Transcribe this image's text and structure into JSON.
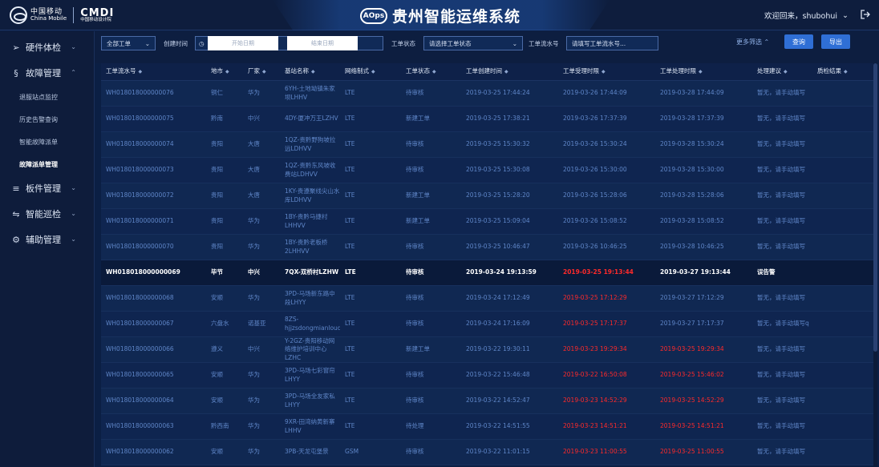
{
  "header": {
    "logo_cn": "中国移动",
    "logo_en": "China Mobile",
    "cmdi": "CMDI",
    "cmdi_sub": "中国移动设计院",
    "aops": "AOps",
    "title": "贵州智能运维系统",
    "welcome": "欢迎回来，shubohui"
  },
  "sidebar": {
    "groups": [
      {
        "label": "硬件体检",
        "icon": "device-icon"
      },
      {
        "label": "故障管理",
        "icon": "fault-icon"
      },
      {
        "label": "板件管理",
        "icon": "stack-icon"
      },
      {
        "label": "智能巡检",
        "icon": "patrol-icon"
      },
      {
        "label": "辅助管理",
        "icon": "gear-icon"
      }
    ],
    "fault_items": [
      "退服站点监控",
      "历史告警查询",
      "智能故障派单",
      "故障派单管理"
    ],
    "active_item": "故障派单管理"
  },
  "filter": {
    "order_type": "全部工单",
    "created_label": "创建时间",
    "start_placeholder": "开始日期",
    "end_placeholder": "结束日期",
    "status_label": "工单状态",
    "status_placeholder": "请选择工单状态",
    "flow_label": "工单流水号",
    "flow_placeholder": "请填写工单流水号...",
    "more": "更多筛选",
    "query": "查询",
    "export": "导出"
  },
  "table": {
    "headers": [
      "工单流水号",
      "地市",
      "厂家",
      "基站名称",
      "网络制式",
      "工单状态",
      "工单创建时间",
      "工单受理时限",
      "工单处理时限",
      "处理建议",
      "质检结果"
    ],
    "rows": [
      {
        "id": "WH018018000000076",
        "city": "铜仁",
        "vendor": "华为",
        "site": "6YH-土地坳镇朱家坝LHHV",
        "net": "LTE",
        "status": "待审核",
        "created": "2019-03-25 17:44:24",
        "accept": "2019-03-26 17:44:09",
        "accept_red": false,
        "deal": "2019-03-28 17:44:09",
        "deal_red": false,
        "advice": "暂无，请手动填写",
        "qc": ""
      },
      {
        "id": "WH018018000000075",
        "city": "黔南",
        "vendor": "中兴",
        "site": "4DY-厦冲万王LZHV",
        "net": "LTE",
        "status": "新建工单",
        "created": "2019-03-25 17:38:21",
        "accept": "2019-03-26 17:37:39",
        "accept_red": false,
        "deal": "2019-03-28 17:37:39",
        "deal_red": false,
        "advice": "暂无，请手动填写",
        "qc": ""
      },
      {
        "id": "WH018018000000074",
        "city": "贵阳",
        "vendor": "大唐",
        "site": "1QZ-贵黔野狗坡拉远LDHVV",
        "net": "LTE",
        "status": "待审核",
        "created": "2019-03-25 15:30:32",
        "accept": "2019-03-26 15:30:24",
        "accept_red": false,
        "deal": "2019-03-28 15:30:24",
        "deal_red": false,
        "advice": "暂无，请手动填写",
        "qc": ""
      },
      {
        "id": "WH018018000000073",
        "city": "贵阳",
        "vendor": "大唐",
        "site": "1QZ-贵黔东风坡收费站LDHVV",
        "net": "LTE",
        "status": "待审核",
        "created": "2019-03-25 15:30:08",
        "accept": "2019-03-26 15:30:00",
        "accept_red": false,
        "deal": "2019-03-28 15:30:00",
        "deal_red": false,
        "advice": "暂无，请手动填写",
        "qc": ""
      },
      {
        "id": "WH018018000000072",
        "city": "贵阳",
        "vendor": "大唐",
        "site": "1KY-贵遵聚线尖山水库LDHVV",
        "net": "LTE",
        "status": "新建工单",
        "created": "2019-03-25 15:28:20",
        "accept": "2019-03-26 15:28:06",
        "accept_red": false,
        "deal": "2019-03-28 15:28:06",
        "deal_red": false,
        "advice": "暂无，请手动填写",
        "qc": ""
      },
      {
        "id": "WH018018000000071",
        "city": "贵阳",
        "vendor": "华为",
        "site": "1BY-贵黔马捷村LHHVV",
        "net": "LTE",
        "status": "新建工单",
        "created": "2019-03-25 15:09:04",
        "accept": "2019-03-26 15:08:52",
        "accept_red": false,
        "deal": "2019-03-28 15:08:52",
        "deal_red": false,
        "advice": "暂无，请手动填写",
        "qc": ""
      },
      {
        "id": "WH018018000000070",
        "city": "贵阳",
        "vendor": "华为",
        "site": "1BY-贵黔老板桥2LHHVV",
        "net": "LTE",
        "status": "待审核",
        "created": "2019-03-25 10:46:47",
        "accept": "2019-03-26 10:46:25",
        "accept_red": false,
        "deal": "2019-03-28 10:46:25",
        "deal_red": false,
        "advice": "暂无，请手动填写",
        "qc": ""
      },
      {
        "id": "WH018018000000069",
        "city": "毕节",
        "vendor": "中兴",
        "site": "7QX-双桥村LZHW",
        "net": "LTE",
        "status": "待审核",
        "created": "2019-03-24 19:13:59",
        "accept": "2019-03-25 19:13:44",
        "accept_red": true,
        "deal": "2019-03-27 19:13:44",
        "deal_red": false,
        "advice": "误告警",
        "qc": ""
      },
      {
        "id": "WH018018000000068",
        "city": "安顺",
        "vendor": "华为",
        "site": "3PD-马场新东路中段LHYY",
        "net": "LTE",
        "status": "待审核",
        "created": "2019-03-24 17:12:49",
        "accept": "2019-03-25 17:12:29",
        "accept_red": true,
        "deal": "2019-03-27 17:12:29",
        "deal_red": false,
        "advice": "暂无，请手动填写",
        "qc": ""
      },
      {
        "id": "WH018018000000067",
        "city": "六盘水",
        "vendor": "诺基亚",
        "site": "8ZS-hjjzsdongmianloudinig2LNYC",
        "net": "LTE",
        "status": "待审核",
        "created": "2019-03-24 17:16:09",
        "accept": "2019-03-25 17:17:37",
        "accept_red": true,
        "deal": "2019-03-27 17:17:37",
        "deal_red": false,
        "advice": "暂无，请手动填写q",
        "qc": ""
      },
      {
        "id": "WH018018000000066",
        "city": "遵义",
        "vendor": "中兴",
        "site": "Y-2GZ-贵阳移动网络维护培训中心LZHC",
        "net": "LTE",
        "status": "新建工单",
        "created": "2019-03-22 19:30:11",
        "accept": "2019-03-23 19:29:34",
        "accept_red": true,
        "deal": "2019-03-25 19:29:34",
        "deal_red": true,
        "advice": "暂无，请手动填写",
        "qc": ""
      },
      {
        "id": "WH018018000000065",
        "city": "安顺",
        "vendor": "华为",
        "site": "3PD-马场七彩窗帘LHYY",
        "net": "LTE",
        "status": "待审核",
        "created": "2019-03-22 15:46:48",
        "accept": "2019-03-22 16:50:08",
        "accept_red": true,
        "deal": "2019-03-25 15:46:02",
        "deal_red": true,
        "advice": "暂无，请手动填写",
        "qc": ""
      },
      {
        "id": "WH018018000000064",
        "city": "安顺",
        "vendor": "华为",
        "site": "3PD-马场全友家私LHYY",
        "net": "LTE",
        "status": "待审核",
        "created": "2019-03-22 14:52:47",
        "accept": "2019-03-23 14:52:29",
        "accept_red": true,
        "deal": "2019-03-25 14:52:29",
        "deal_red": true,
        "advice": "暂无，请手动填写",
        "qc": ""
      },
      {
        "id": "WH018018000000063",
        "city": "黔西南",
        "vendor": "华为",
        "site": "9XR-田湾纳黄新寨LHHV",
        "net": "LTE",
        "status": "待处理",
        "created": "2019-03-22 14:51:55",
        "accept": "2019-03-23 14:51:21",
        "accept_red": true,
        "deal": "2019-03-25 14:51:21",
        "deal_red": true,
        "advice": "暂无，请手动填写",
        "qc": ""
      },
      {
        "id": "WH018018000000062",
        "city": "安顺",
        "vendor": "华为",
        "site": "3PB-天龙屯堡景",
        "net": "GSM",
        "status": "待审核",
        "created": "2019-03-22 11:01:15",
        "accept": "2019-03-23 11:00:55",
        "accept_red": true,
        "deal": "2019-03-25 11:00:55",
        "deal_red": true,
        "advice": "暂无，请手动填写",
        "qc": ""
      }
    ]
  }
}
